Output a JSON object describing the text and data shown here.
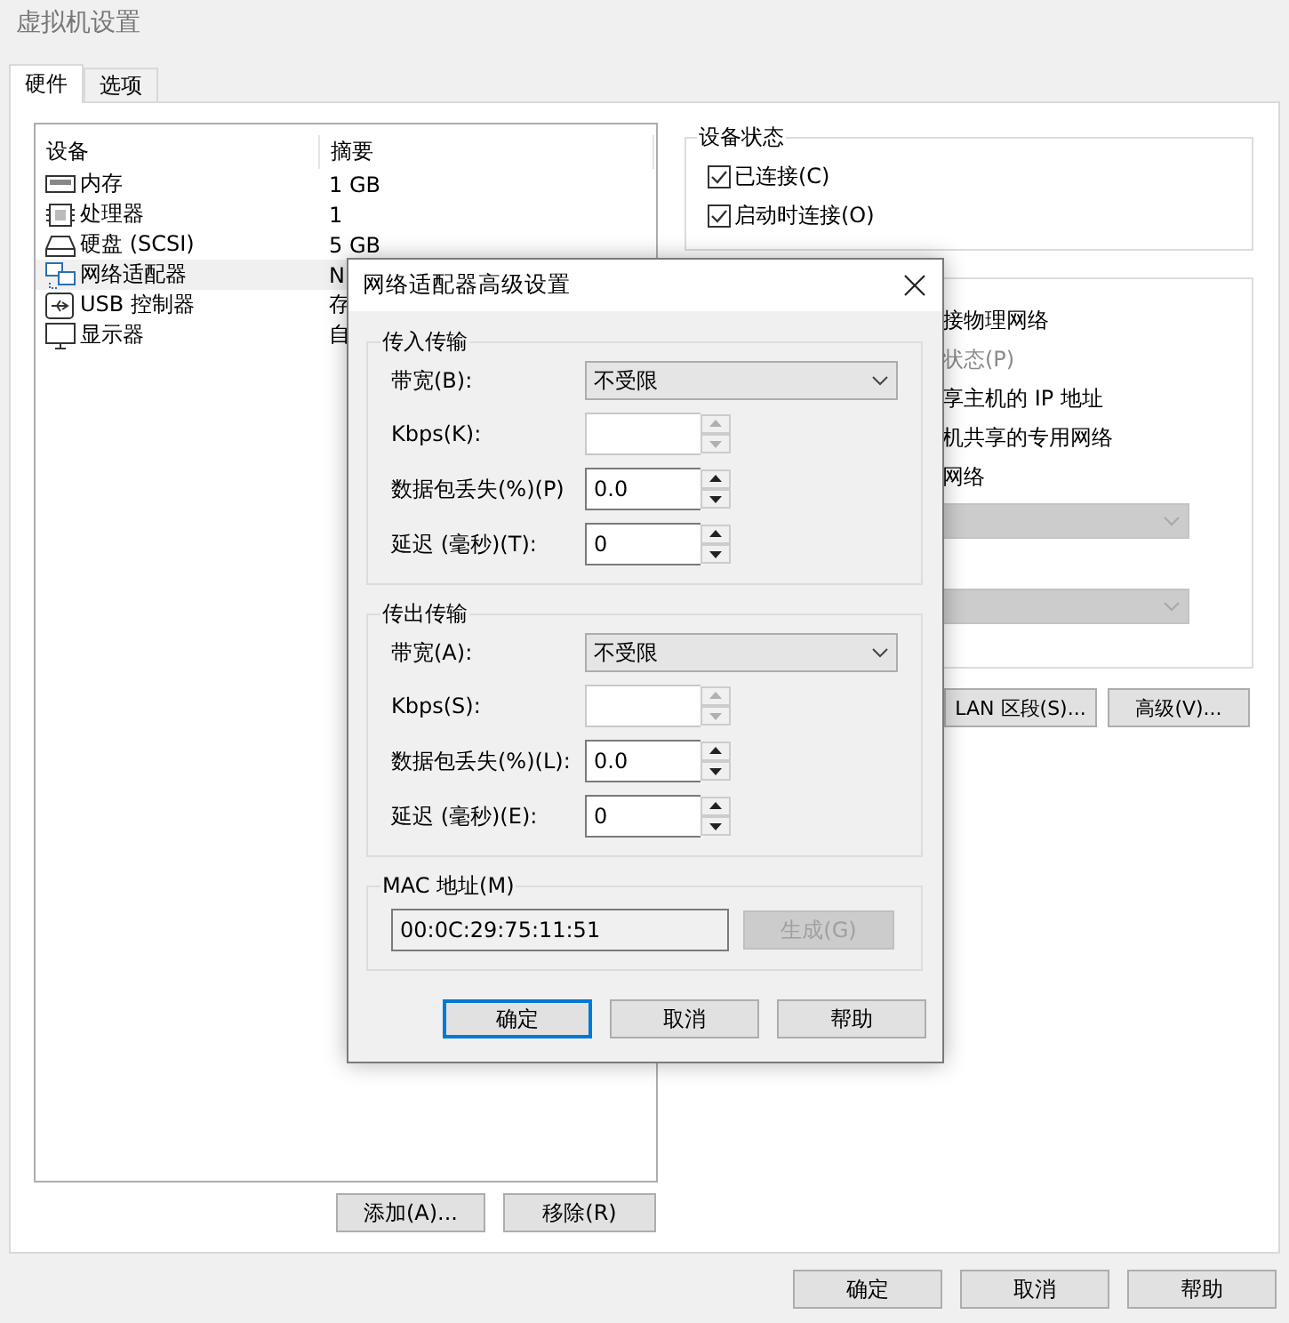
{
  "window": {
    "title": "虚拟机设置"
  },
  "tabs": [
    {
      "label": "硬件",
      "selected": true
    },
    {
      "label": "选项",
      "selected": false
    }
  ],
  "device_list": {
    "columns": [
      "设备",
      "摘要"
    ],
    "rows": [
      {
        "name": "内存",
        "summary": "1 GB",
        "selected": false
      },
      {
        "name": "处理器",
        "summary": "1",
        "selected": false
      },
      {
        "name": "硬盘 (SCSI)",
        "summary": "5 GB",
        "selected": false
      },
      {
        "name": "网络适配器",
        "summary": "N",
        "selected": true
      },
      {
        "name": "USB 控制器",
        "summary": "存",
        "selected": false
      },
      {
        "name": "显示器",
        "summary": "自",
        "selected": false
      }
    ]
  },
  "list_buttons": [
    "添加(A)...",
    "移除(R)"
  ],
  "device_status": {
    "title": "设备状态",
    "checkboxes": [
      {
        "label": "已连接(C)",
        "checked": true
      },
      {
        "label": "启动时连接(O)",
        "checked": true
      }
    ]
  },
  "network_connection": {
    "items": [
      {
        "kind": "text",
        "label": "接物理网络",
        "disabled": false
      },
      {
        "kind": "text",
        "label": "状态(P)",
        "disabled": true
      },
      {
        "kind": "text",
        "label": "享主机的 IP 地址",
        "disabled": false
      },
      {
        "kind": "text",
        "label": "机共享的专用网络",
        "disabled": false
      },
      {
        "kind": "text",
        "label": "网络",
        "disabled": false
      },
      {
        "kind": "dropdown",
        "disabled": true
      },
      {
        "kind": "dropdown",
        "disabled": true
      }
    ],
    "buttons": [
      "LAN 区段(S)...",
      "高级(V)..."
    ]
  },
  "footer_buttons": [
    "确定",
    "取消",
    "帮助"
  ],
  "dialog": {
    "title": "网络适配器高级设置",
    "groups": [
      {
        "title": "传入传输",
        "fields": [
          {
            "kind": "dropdown",
            "label": "带宽(B):",
            "value": "不受限"
          },
          {
            "kind": "spin",
            "label": "Kbps(K):",
            "disabled": true
          },
          {
            "kind": "spin",
            "label": "数据包丢失(%)(P)",
            "value": "0.0",
            "disabled": false
          },
          {
            "kind": "spin",
            "label": "延迟 (毫秒)(T):",
            "value": "0",
            "disabled": false
          }
        ]
      },
      {
        "title": "传出传输",
        "fields": [
          {
            "kind": "dropdown",
            "label": "带宽(A):",
            "value": "不受限"
          },
          {
            "kind": "spin",
            "label": "Kbps(S):",
            "disabled": true
          },
          {
            "kind": "spin",
            "label": "数据包丢失(%)(L):",
            "value": "0.0",
            "disabled": false
          },
          {
            "kind": "spin",
            "label": "延迟 (毫秒)(E):",
            "value": "0",
            "disabled": false
          }
        ]
      }
    ],
    "mac": {
      "title": "MAC 地址(M)",
      "value": "00:0C:29:75:11:51",
      "button": {
        "label": "生成(G)",
        "disabled": true
      }
    },
    "buttons": [
      {
        "label": "确定",
        "focused": true
      },
      {
        "label": "取消",
        "focused": false
      },
      {
        "label": "帮助",
        "focused": false
      }
    ]
  }
}
